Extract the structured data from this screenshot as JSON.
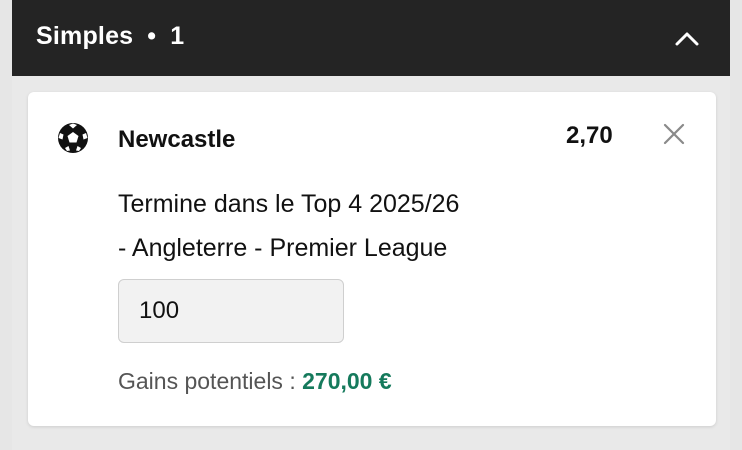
{
  "header": {
    "title": "Simples",
    "separator": "•",
    "count": "1",
    "collapse_icon": "chevron-up-icon"
  },
  "bet": {
    "sport_icon": "football-icon",
    "team": "Newcastle",
    "odds": "2,70",
    "remove_icon": "close-icon",
    "market_line1": "Termine dans le Top 4 2025/26",
    "market_line2": "- Angleterre - Premier League",
    "stake_value": "100",
    "gains_label": "Gains potentiels : ",
    "gains_amount": "270,00 €"
  },
  "colors": {
    "header_bg": "#242424",
    "gains_accent": "#157a5c"
  }
}
